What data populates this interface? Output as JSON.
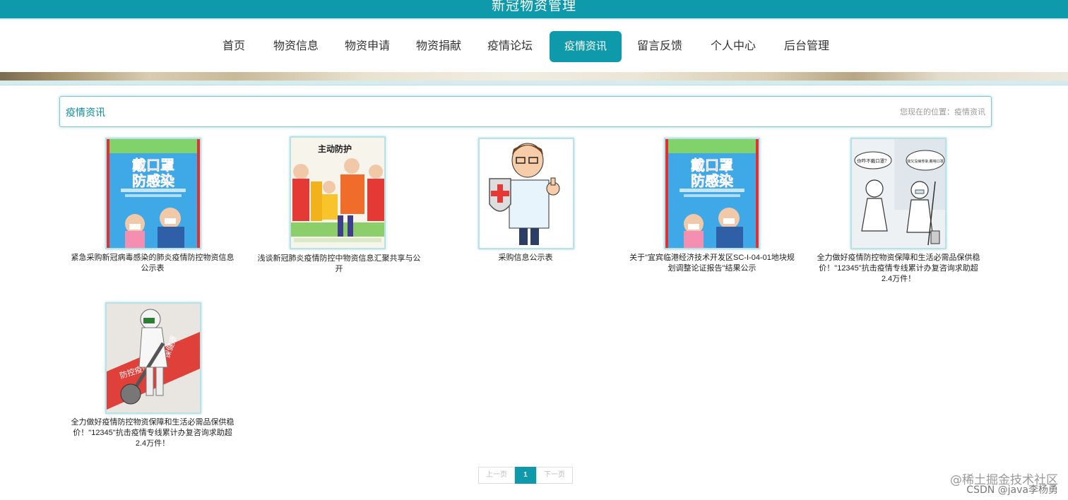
{
  "header": {
    "site_title": "新冠物资管理"
  },
  "nav": {
    "items": [
      "首页",
      "物资信息",
      "物资申请",
      "物资捐献",
      "疫情论坛",
      "疫情资讯",
      "留言反馈",
      "个人中心",
      "后台管理"
    ],
    "active": "疫情资讯"
  },
  "section": {
    "title": "疫情资讯",
    "breadcrumb": "您现在的位置：疫情资讯"
  },
  "articles": [
    {
      "title": "紧急采购新冠病毒感染的肺炎疫情防控物资信息公示表",
      "poster_text": [
        "戴口罩",
        "防感染"
      ]
    },
    {
      "title": "浅谈新冠肺炎疫情防控中物资信息汇聚共享与公开",
      "poster_text": [
        "主动防护"
      ]
    },
    {
      "title": "采购信息公示表"
    },
    {
      "title": "关于\"宜宾临港经济技术开发区SC-I-04-01地块规划调整论证报告\"结果公示",
      "poster_text": [
        "戴口罩",
        "防感染"
      ]
    },
    {
      "title": "全力做好疫情防控物资保障和生活必需品保供稳价！\"12345\"抗击疫情专线累计办复咨询求助超2.4万件！",
      "poster_text": [
        "你咋不戴口罩？",
        "我又没病传染,戴啥口罩"
      ]
    },
    {
      "title": "全力做好疫情防控物资保障和生活必需品保供稳价！\"12345\"抗击疫情专线累计办复咨询求助超2.4万件！",
      "poster_text": [
        "防控疫情",
        "保健康"
      ]
    }
  ],
  "pagination": {
    "prev": "上一页",
    "current": "1",
    "next": "下一页"
  },
  "watermark": {
    "line1": "@稀土掘金技术社区",
    "line2": "CSDN @java李杨勇"
  },
  "colors": {
    "accent": "#0e9aaa"
  }
}
